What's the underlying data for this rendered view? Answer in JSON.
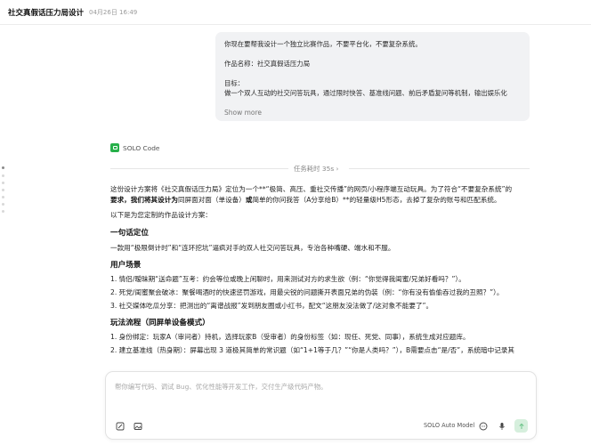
{
  "header": {
    "title": "社交真假话压力局设计",
    "date": "04月26日 16:49"
  },
  "user_message": {
    "lines": [
      "你现在要帮我设计一个独立比赛作品，不要平台化，不要复杂系统。",
      "",
      "作品名称：社交真假话压力局",
      "",
      "目标：",
      "做一个双人互动的社交问答玩具，通过限时快答、基准线问题、前后矛盾复问等机制，输出娱乐化"
    ],
    "show_more": "Show more"
  },
  "agent": {
    "name": "SOLO Code",
    "task_time": "任务耗时 35s ›"
  },
  "response": {
    "intro_1": "这份设计方案将《社交真假话压力局》定位为一个**“极简、高压、重社交传播”的网页/小程序端互动玩具。为了符合“不要复杂系统”的",
    "intro_2a": "要求，我们将其设计为",
    "intro_2b": "同屏面对面（单设备）",
    "intro_2c": "或",
    "intro_2d": "简单的你问我答（A分享给B）",
    "intro_2e": "**的轻量级H5形态，去掉了复杂的账号和匹配系统。",
    "intro_3": "以下是为您定制的作品设计方案：",
    "sec1_title": "一句话定位",
    "sec1_text": "一款用“极限倒计时”和“连环挖坑”逼疯对手的双人社交问答玩具，专治各种嘴硬、端水和不服。",
    "sec2_title": "用户场景",
    "scenes": [
      "1. 情侣/暧昧期“送命题”互考：约会等位或晚上闲聊时，用来测试对方的求生欲（例：“你觉得我闺蜜/兄弟好看吗？”）。",
      "2. 死党/闺蜜聚会破冰：聚餐喝酒时的快速惩罚游戏，用最尖锐的问题撕开表面兄弟的伪装（例：“你有没有偷偷吞过我的丑照？”）。",
      "3. 社交媒体吃瓜分享：把测出的“离谱战报”发到朋友圈或小红书，配文“这朋友没法做了/这对象不能要了”。"
    ],
    "sec3_title": "玩法流程（同屏单设备模式）",
    "steps": [
      "1. 身份绑定：玩家A（审问者）持机，选择玩家B（受审者）的身份标签（如：现任、死党、同事），系统生成对应题库。",
      "2. 建立基准线（热身期）：屏幕出现 3 道极其简单的常识题（如“1+1等于几？”“你是人类吗？”），B需要点击“是/否”，系统暗中记录其"
    ]
  },
  "composer": {
    "placeholder": "帮你编写代码、调试 Bug、优化性能等开发工作，交付生产级代码产物。",
    "model": "SOLO Auto Model"
  },
  "colors": {
    "accent_green": "#27b04a",
    "bubble_bg": "#f1f2f4",
    "send_bg": "#d6efdd"
  }
}
